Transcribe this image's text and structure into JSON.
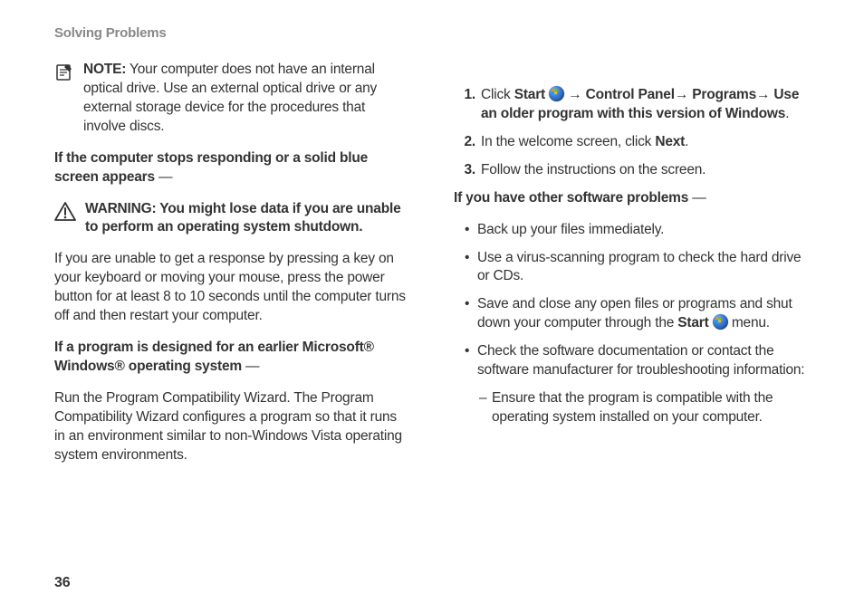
{
  "header": "Solving Problems",
  "note": {
    "label": "NOTE:",
    "text": " Your computer does not have an internal optical drive. Use an external optical drive or any external storage device for the procedures that involve discs."
  },
  "heading_stops": {
    "bold": "If the computer stops responding or a solid blue screen appears",
    "tail": " —"
  },
  "warning": "WARNING: You might lose data if you are unable to perform an operating system shutdown.",
  "para_noresponse": "If you are unable to get a response by pressing a key on your keyboard or moving your mouse, press the power button for at least 8 to 10 seconds until the computer turns off and then restart your computer.",
  "heading_earlier": {
    "bold": "If a program is designed for an earlier Microsoft® Windows® operating system",
    "tail": " —"
  },
  "para_compat": "Run the Program Compatibility Wizard. The Program Compatibility Wizard configures a program so that it runs in an environment similar to non-Windows Vista operating system environments.",
  "steps": [
    {
      "num": "1.",
      "pre": "Click ",
      "b1": "Start",
      "mid1": " ",
      "arrow1": " → ",
      "b2": "Control Panel",
      "arrow2": "→ ",
      "b3": "Programs",
      "arrow3": "→ ",
      "b4": "Use an older program with this version of Windows",
      "post": "."
    },
    {
      "num": "2.",
      "pre": "In the welcome screen, click ",
      "b1": "Next",
      "post": "."
    },
    {
      "num": "3.",
      "pre": "Follow the instructions on the screen."
    }
  ],
  "heading_other": {
    "bold": "If you have other software problems",
    "tail": " —"
  },
  "bullets": [
    {
      "text": "Back up your files immediately."
    },
    {
      "text": "Use a virus-scanning program to check the hard drive or CDs."
    },
    {
      "pre": "Save and close any open files or programs and shut down your computer through the ",
      "b1": "Start",
      "post": " ",
      "post2": " menu."
    },
    {
      "text": "Check the software documentation or contact the software manufacturer for troubleshooting information:"
    }
  ],
  "sub_bullet": "Ensure that the program is compatible with the operating system installed on your computer.",
  "page_number": "36"
}
